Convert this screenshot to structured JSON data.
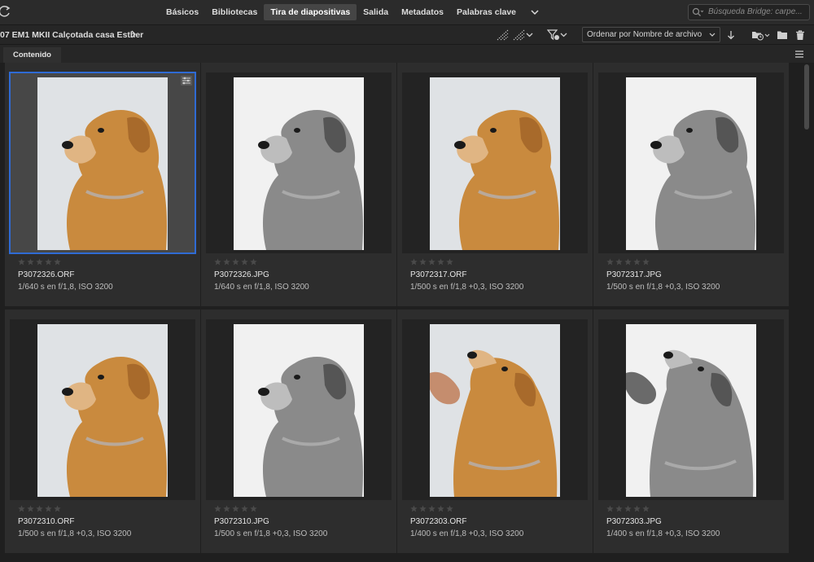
{
  "workspaces": [
    "Básicos",
    "Bibliotecas",
    "Tira de diapositivas",
    "Salida",
    "Metadatos",
    "Palabras clave"
  ],
  "active_workspace_index": 2,
  "search": {
    "placeholder": "Búsqueda Bridge: carpe..."
  },
  "path": {
    "label": "07 EM1 MKII Calçotada casa Esther"
  },
  "sort": {
    "label": "Ordenar por Nombre de archivo"
  },
  "panel": {
    "tab_label": "Contenido"
  },
  "colors": {
    "selection": "#2f6bd4",
    "background": "#1f1f1f",
    "cell": "#2d2d2d"
  },
  "items": [
    {
      "name": "P3072326.ORF",
      "meta": "1/640 s en f/1,8, ISO 3200",
      "tone": "color",
      "pose": "profile",
      "selected": true,
      "adjusted": true,
      "rating": 0
    },
    {
      "name": "P3072326.JPG",
      "meta": "1/640 s en f/1,8, ISO 3200",
      "tone": "bw",
      "pose": "profile",
      "selected": false,
      "adjusted": false,
      "rating": 0
    },
    {
      "name": "P3072317.ORF",
      "meta": "1/500 s en f/1,8 +0,3, ISO 3200",
      "tone": "color",
      "pose": "profile",
      "selected": false,
      "adjusted": false,
      "rating": 0
    },
    {
      "name": "P3072317.JPG",
      "meta": "1/500 s en f/1,8 +0,3, ISO 3200",
      "tone": "bw",
      "pose": "profile",
      "selected": false,
      "adjusted": false,
      "rating": 0
    },
    {
      "name": "P3072310.ORF",
      "meta": "1/500 s en f/1,8 +0,3, ISO 3200",
      "tone": "color",
      "pose": "profile",
      "selected": false,
      "adjusted": false,
      "rating": 0
    },
    {
      "name": "P3072310.JPG",
      "meta": "1/500 s en f/1,8 +0,3, ISO 3200",
      "tone": "bw",
      "pose": "profile",
      "selected": false,
      "adjusted": false,
      "rating": 0
    },
    {
      "name": "P3072303.ORF",
      "meta": "1/400 s en f/1,8 +0,3, ISO 3200",
      "tone": "color",
      "pose": "up-hand",
      "selected": false,
      "adjusted": false,
      "rating": 0
    },
    {
      "name": "P3072303.JPG",
      "meta": "1/400 s en f/1,8 +0,3, ISO 3200",
      "tone": "bw",
      "pose": "up-hand",
      "selected": false,
      "adjusted": false,
      "rating": 0
    }
  ]
}
